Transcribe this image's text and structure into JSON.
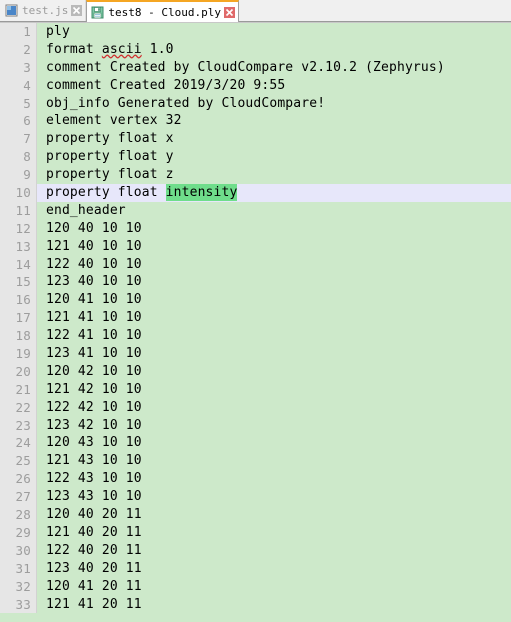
{
  "window": {
    "title": "test8 - Cloud.ply"
  },
  "colors": {
    "editor_background": "#cde9ca",
    "gutter_background": "#e6e6e6",
    "gutter_text": "#9d9d9d",
    "current_line_background": "#e7e7fa",
    "selection_background": "#6fdd8b",
    "active_tab_accent": "#f5a623",
    "tabbar_background": "#f0f0f0",
    "inactive_tab_text": "#9b9b9b",
    "text": "#000000",
    "spellcheck_underline": "#d03030"
  },
  "tabs": [
    {
      "label": "test.js",
      "icon": "js-file-icon",
      "close_icon": "close-icon",
      "active": false
    },
    {
      "label": "test8 - Cloud.ply",
      "icon": "save-floppy-icon",
      "close_icon": "close-icon",
      "active": true
    }
  ],
  "editor": {
    "current_line_number": 10,
    "selection_text": "intensity",
    "first_visible_line": 1,
    "lines": [
      {
        "n": 1,
        "text": "ply"
      },
      {
        "n": 2,
        "text": "format ascii 1.0",
        "misspelled": "ascii"
      },
      {
        "n": 3,
        "text": "comment Created by CloudCompare v2.10.2 (Zephyrus)"
      },
      {
        "n": 4,
        "text": "comment Created 2019/3/20 9:55"
      },
      {
        "n": 5,
        "text": "obj_info Generated by CloudCompare!"
      },
      {
        "n": 6,
        "text": "element vertex 32"
      },
      {
        "n": 7,
        "text": "property float x"
      },
      {
        "n": 8,
        "text": "property float y"
      },
      {
        "n": 9,
        "text": "property float z"
      },
      {
        "n": 10,
        "text": "property float intensity",
        "prefix": "property float ",
        "selected": "intensity",
        "current": true
      },
      {
        "n": 11,
        "text": "end_header"
      },
      {
        "n": 12,
        "text": "120 40 10 10"
      },
      {
        "n": 13,
        "text": "121 40 10 10"
      },
      {
        "n": 14,
        "text": "122 40 10 10"
      },
      {
        "n": 15,
        "text": "123 40 10 10"
      },
      {
        "n": 16,
        "text": "120 41 10 10"
      },
      {
        "n": 17,
        "text": "121 41 10 10"
      },
      {
        "n": 18,
        "text": "122 41 10 10"
      },
      {
        "n": 19,
        "text": "123 41 10 10"
      },
      {
        "n": 20,
        "text": "120 42 10 10"
      },
      {
        "n": 21,
        "text": "121 42 10 10"
      },
      {
        "n": 22,
        "text": "122 42 10 10"
      },
      {
        "n": 23,
        "text": "123 42 10 10"
      },
      {
        "n": 24,
        "text": "120 43 10 10"
      },
      {
        "n": 25,
        "text": "121 43 10 10"
      },
      {
        "n": 26,
        "text": "122 43 10 10"
      },
      {
        "n": 27,
        "text": "123 43 10 10"
      },
      {
        "n": 28,
        "text": "120 40 20 11"
      },
      {
        "n": 29,
        "text": "121 40 20 11"
      },
      {
        "n": 30,
        "text": "122 40 20 11"
      },
      {
        "n": 31,
        "text": "123 40 20 11"
      },
      {
        "n": 32,
        "text": "120 41 20 11"
      },
      {
        "n": 33,
        "text": "121 41 20 11"
      }
    ]
  }
}
